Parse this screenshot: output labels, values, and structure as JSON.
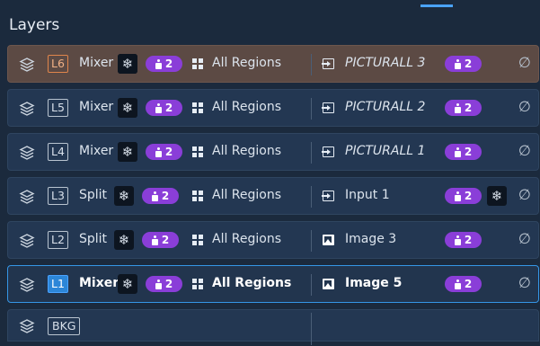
{
  "panel": {
    "title": "Layers"
  },
  "icons": {
    "layer": "layers-stack-icon",
    "freeze": "snowflake-icon",
    "outputs": "person-icon",
    "regions": "grid-icon",
    "source_input": "input-source-icon",
    "source_image": "image-icon",
    "none": "empty-set-icon"
  },
  "colors": {
    "accent": "#3596e6",
    "pill": "#8a3ed8",
    "l6_bg": "#5c4a44",
    "tag_orange": "#e0854b"
  },
  "layers": [
    {
      "id": "L6",
      "type": "Mixer",
      "outputs": "2",
      "regions": "All Regions",
      "source": "PICTURALL 3",
      "source_outputs": "2",
      "source_kind": "input",
      "none": "∅"
    },
    {
      "id": "L5",
      "type": "Mixer",
      "outputs": "2",
      "regions": "All Regions",
      "source": "PICTURALL 2",
      "source_outputs": "2",
      "source_kind": "input",
      "none": "∅"
    },
    {
      "id": "L4",
      "type": "Mixer",
      "outputs": "2",
      "regions": "All Regions",
      "source": "PICTURALL 1",
      "source_outputs": "2",
      "source_kind": "input",
      "none": "∅"
    },
    {
      "id": "L3",
      "type": "Split",
      "outputs": "2",
      "regions": "All Regions",
      "source": "Input 1",
      "source_outputs": "2",
      "source_kind": "input",
      "none": "∅"
    },
    {
      "id": "L2",
      "type": "Split",
      "outputs": "2",
      "regions": "All Regions",
      "source": "Image 3",
      "source_outputs": "2",
      "source_kind": "image",
      "none": "∅"
    },
    {
      "id": "L1",
      "type": "Mixer",
      "outputs": "2",
      "regions": "All Regions",
      "source": "Image 5",
      "source_outputs": "2",
      "source_kind": "image",
      "none": "∅"
    },
    {
      "id": "BKG"
    }
  ]
}
